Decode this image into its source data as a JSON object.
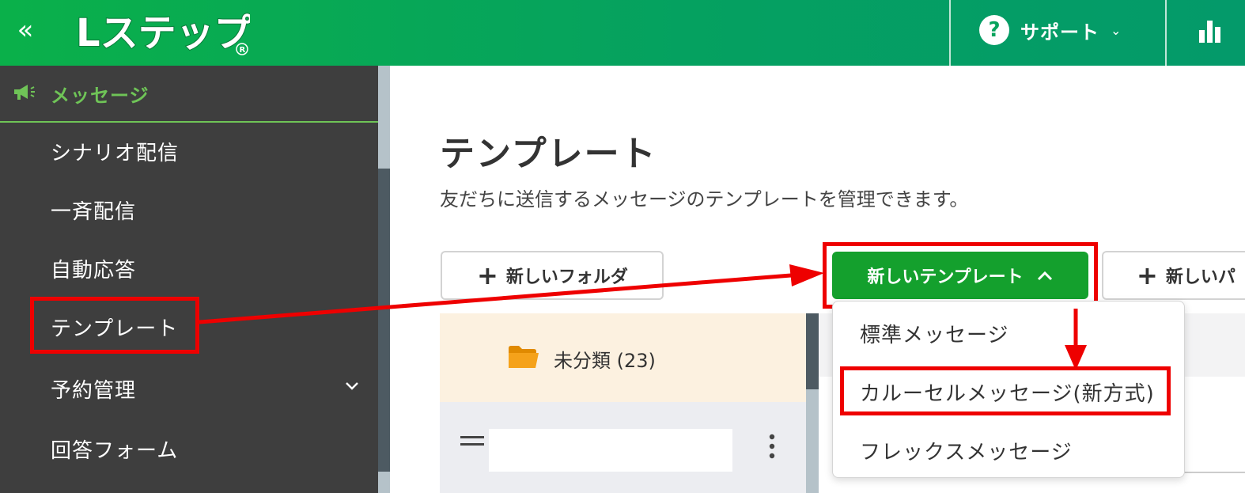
{
  "header": {
    "collapse_glyph": "«",
    "logo_text": "Lステップ",
    "support_label": "サポート",
    "support_icon_glyph": "?",
    "dropdown_glyph": "⌄"
  },
  "sidebar": {
    "section_title": "メッセージ",
    "items": [
      {
        "label": "シナリオ配信"
      },
      {
        "label": "一斉配信"
      },
      {
        "label": "自動応答"
      },
      {
        "label": "テンプレート"
      },
      {
        "label": "予約管理"
      },
      {
        "label": "回答フォーム"
      }
    ]
  },
  "main": {
    "title": "テンプレート",
    "description": "友だちに送信するメッセージのテンプレートを管理できます。",
    "new_folder_label": "新しいフォルダ",
    "new_template_label": "新しいテンプレート",
    "new_pack_label": "新しいパ",
    "plus_glyph": "+",
    "folder_label": "未分類 (23)"
  },
  "dropdown": {
    "items": [
      {
        "label": "標準メッセージ"
      },
      {
        "label": "カルーセルメッセージ(新方式)"
      },
      {
        "label": "フレックスメッセージ"
      }
    ]
  },
  "colors": {
    "header_green": "#05a160",
    "button_green": "#14a02d",
    "annotation_red": "#ee0000",
    "sidebar_bg": "#3e3e3e",
    "sidebar_accent": "#6fc457"
  }
}
